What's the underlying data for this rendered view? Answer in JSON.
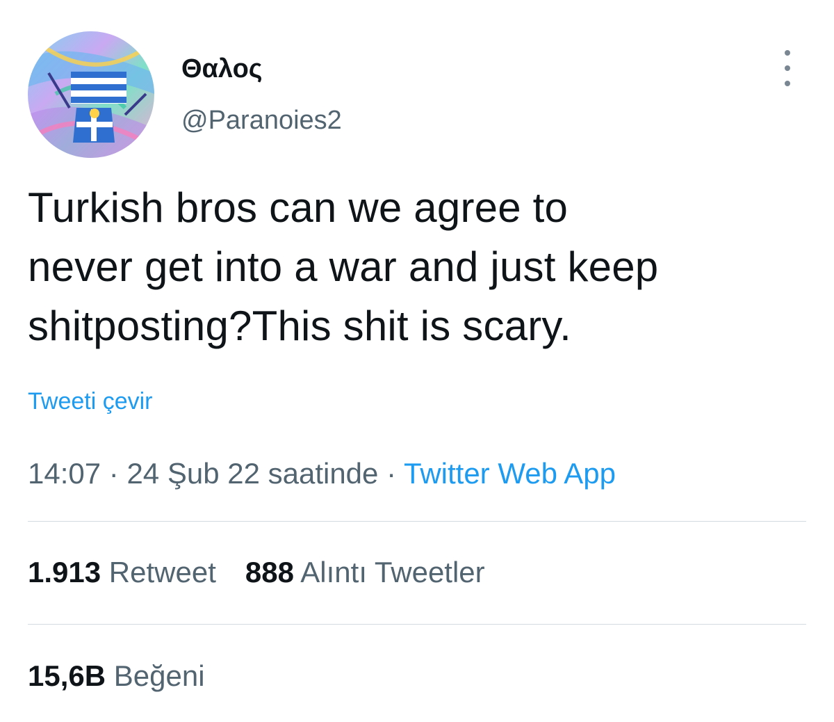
{
  "author": {
    "display_name": "Θαλος",
    "handle": "@Paranoies2"
  },
  "tweet": {
    "text": "Turkish bros can we agree to\nnever get into a war and just keep\nshitposting?This shit is scary.",
    "translate_label": "Tweeti çevir"
  },
  "meta": {
    "time": "14:07",
    "separator": " · ",
    "date": "24 Şub 22 saatinde",
    "source": "Twitter Web App"
  },
  "stats": {
    "retweets": {
      "count": "1.913",
      "label": "Retweet"
    },
    "quotes": {
      "count": "888",
      "label": "Alıntı Tweetler"
    },
    "likes": {
      "count": "15,6B",
      "label": "Beğeni"
    }
  },
  "icons": {
    "more": "more-options-icon"
  },
  "colors": {
    "link": "#1d9bf0",
    "text": "#0f1419",
    "secondary": "#536471",
    "divider": "#d3dbe1"
  }
}
